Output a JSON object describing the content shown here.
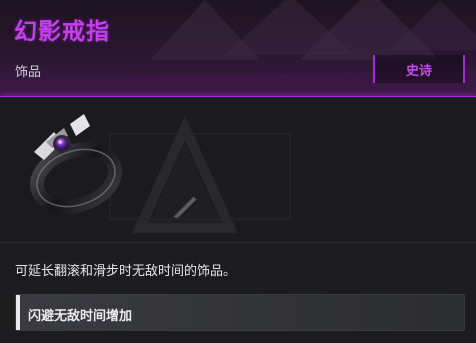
{
  "item": {
    "name": "幻影戒指",
    "category": "饰品",
    "rarity": "史诗",
    "description": "可延长翻滚和滑步时无敌时间的饰品。",
    "effects": [
      {
        "label": "闪避无敌时间增加"
      }
    ],
    "icon": "ring-icon"
  },
  "colors": {
    "rarity_accent": "#c53ff0",
    "header_line": "#b227d8",
    "panel_bg": "#1c1c1e"
  }
}
